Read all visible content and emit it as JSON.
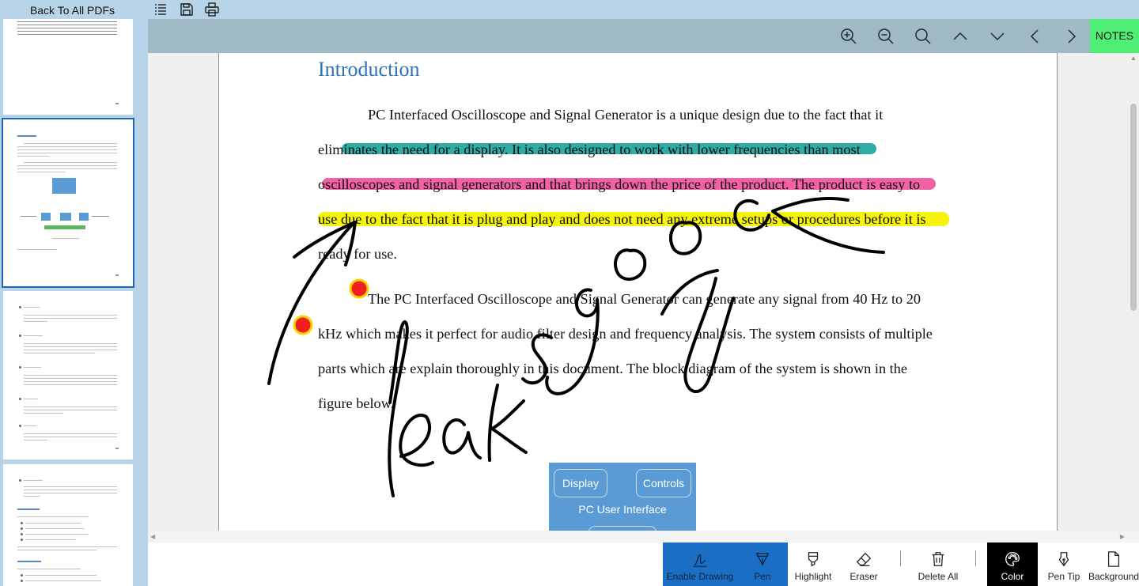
{
  "topbar": {
    "back_label": "Back To All PDFs",
    "icons": [
      "list-icon",
      "save-icon",
      "print-icon"
    ]
  },
  "toolbar": {
    "icons": [
      "zoom-in-icon",
      "zoom-out-icon",
      "search-icon",
      "chevron-up-icon",
      "chevron-down-icon",
      "chevron-left-icon",
      "chevron-right-icon"
    ],
    "notes_label": "NOTES",
    "notes_color": "#4eef74"
  },
  "document": {
    "heading": "Introduction",
    "lines": [
      "PC Interfaced Oscilloscope and Signal Generator is a unique design due to the fact that it",
      "eliminates the need for a display. It is also designed to work with lower frequencies than most",
      "oscilloscopes and signal generators and that brings down the price of the product. The product is easy to",
      "use due to the fact that it is plug and play and does not need any extreme setups or procedures before it is",
      "ready for use.",
      "The PC Interfaced Oscilloscope and Signal Generator can generate any signal from 40 Hz to 20",
      "kHz which makes it perfect for audio filter design and frequency analysis. The system consists of multiple",
      "parts which are explain thoroughly in this document. The block diagram of the system is shown in the",
      "figure below."
    ],
    "highlight_colors": [
      "#18a39a",
      "#f0509a",
      "#f6f200"
    ],
    "diagram": {
      "display_label": "Display",
      "controls_label": "Controls",
      "title": "PC User Interface"
    }
  },
  "commands": [
    {
      "label": "Enable Drawing",
      "icon": "pen-signature-icon",
      "state": "active"
    },
    {
      "label": "Pen",
      "icon": "pen-nib-icon",
      "state": "active"
    },
    {
      "label": "Highlight",
      "icon": "highlighter-icon",
      "state": "normal"
    },
    {
      "label": "Eraser",
      "icon": "eraser-icon",
      "state": "normal"
    },
    {
      "label": "Delete All",
      "icon": "trash-icon",
      "state": "normal"
    },
    {
      "label": "Color",
      "icon": "palette-icon",
      "state": "dark"
    },
    {
      "label": "Pen Tip",
      "icon": "pen-tip-icon",
      "state": "normal"
    },
    {
      "label": "Background",
      "icon": "page-icon",
      "state": "normal"
    }
  ],
  "theme": {
    "sidebar_bg": "#b7d4e9",
    "toolbar_bg": "#9fb9c6",
    "active_blue": "#1a6fc4",
    "heading_blue": "#2e74b5"
  }
}
